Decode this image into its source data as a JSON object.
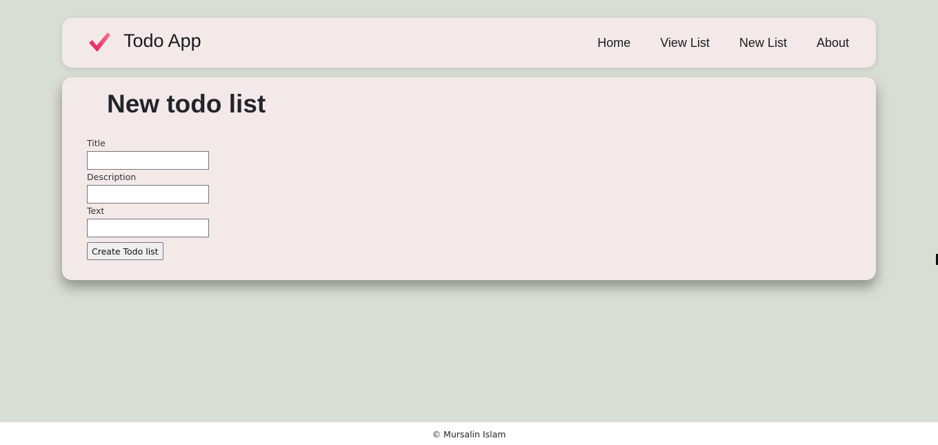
{
  "header": {
    "logo_icon": "checkmark-icon",
    "app_title": "Todo App",
    "nav": [
      {
        "label": "Home"
      },
      {
        "label": "View List"
      },
      {
        "label": "New List"
      },
      {
        "label": "About"
      }
    ]
  },
  "main": {
    "title": "New todo list",
    "fields": [
      {
        "label": "Title",
        "value": ""
      },
      {
        "label": "Description",
        "value": ""
      },
      {
        "label": "Text",
        "value": ""
      }
    ],
    "submit_label": "Create Todo list"
  },
  "footer": {
    "text": "© Mursalin Islam"
  },
  "colors": {
    "page_background": "#d8ded5",
    "card_background": "#f4e9e9",
    "logo_accent": "#e8336b"
  }
}
